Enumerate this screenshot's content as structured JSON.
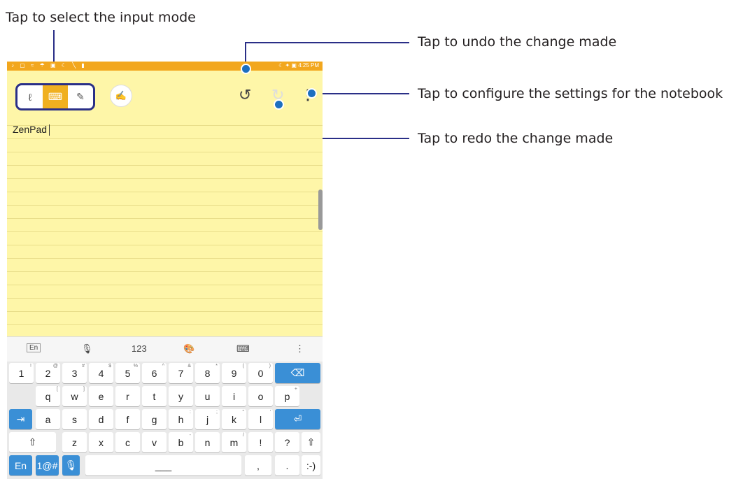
{
  "callouts": {
    "input_mode": "Tap to select the input mode",
    "undo": "Tap to undo the change made",
    "settings": "Tap to configure the settings for the notebook",
    "redo": "Tap to redo the change made"
  },
  "status": {
    "left_icons": "♪ ▢ ≈ ☂ ▣ ☾ ╲ ▮",
    "right": "☾ ✦ ▣ 4:25 PM"
  },
  "toolbar": {
    "modes": [
      "handwriting-icon",
      "keyboard-icon",
      "pen-icon"
    ],
    "active_mode_index": 1,
    "undo_icon": "undo-icon",
    "redo_icon": "redo-icon",
    "more_icon": "more-vertical-icon"
  },
  "note": {
    "text": "ZenPad"
  },
  "kb_top": {
    "lang": "En",
    "mic": "🎙",
    "num": "123",
    "theme": "🎨",
    "kbd": "⌨",
    "more": "⋮"
  },
  "keyboard": {
    "row1": [
      [
        "1",
        "!"
      ],
      [
        "2",
        "@"
      ],
      [
        "3",
        "#"
      ],
      [
        "4",
        "$"
      ],
      [
        "5",
        "%"
      ],
      [
        "6",
        "^"
      ],
      [
        "7",
        "&"
      ],
      [
        "8",
        "*"
      ],
      [
        "9",
        "("
      ],
      [
        "0",
        ")"
      ]
    ],
    "row2": [
      [
        "q",
        "["
      ],
      [
        "w",
        "]"
      ],
      [
        "e",
        ""
      ],
      [
        "r",
        ""
      ],
      [
        "t",
        ""
      ],
      [
        "y",
        ""
      ],
      [
        "u",
        ""
      ],
      [
        "i",
        ""
      ],
      [
        "o",
        ""
      ],
      [
        "p",
        "+"
      ]
    ],
    "row3": [
      [
        "a",
        ""
      ],
      [
        "s",
        ""
      ],
      [
        "d",
        ""
      ],
      [
        "f",
        ""
      ],
      [
        "g",
        ""
      ],
      [
        "h",
        ":"
      ],
      [
        "j",
        ";"
      ],
      [
        "k",
        "\""
      ],
      [
        "l",
        "'"
      ]
    ],
    "row4": [
      [
        "z",
        ""
      ],
      [
        "x",
        ""
      ],
      [
        "c",
        ""
      ],
      [
        "v",
        ""
      ],
      [
        "b",
        "-"
      ],
      [
        "n",
        ""
      ],
      [
        "m",
        "/"
      ],
      [
        "!",
        ""
      ],
      [
        "?",
        ""
      ]
    ],
    "backspace": "⌫",
    "tab": "⇥",
    "enter": "⏎",
    "shift": "⇧",
    "lang": "En",
    "symbols": "1@#",
    "mic": "🎙",
    "space": "___",
    "comma": ",",
    "period": ".",
    "smiley": ":-)"
  }
}
